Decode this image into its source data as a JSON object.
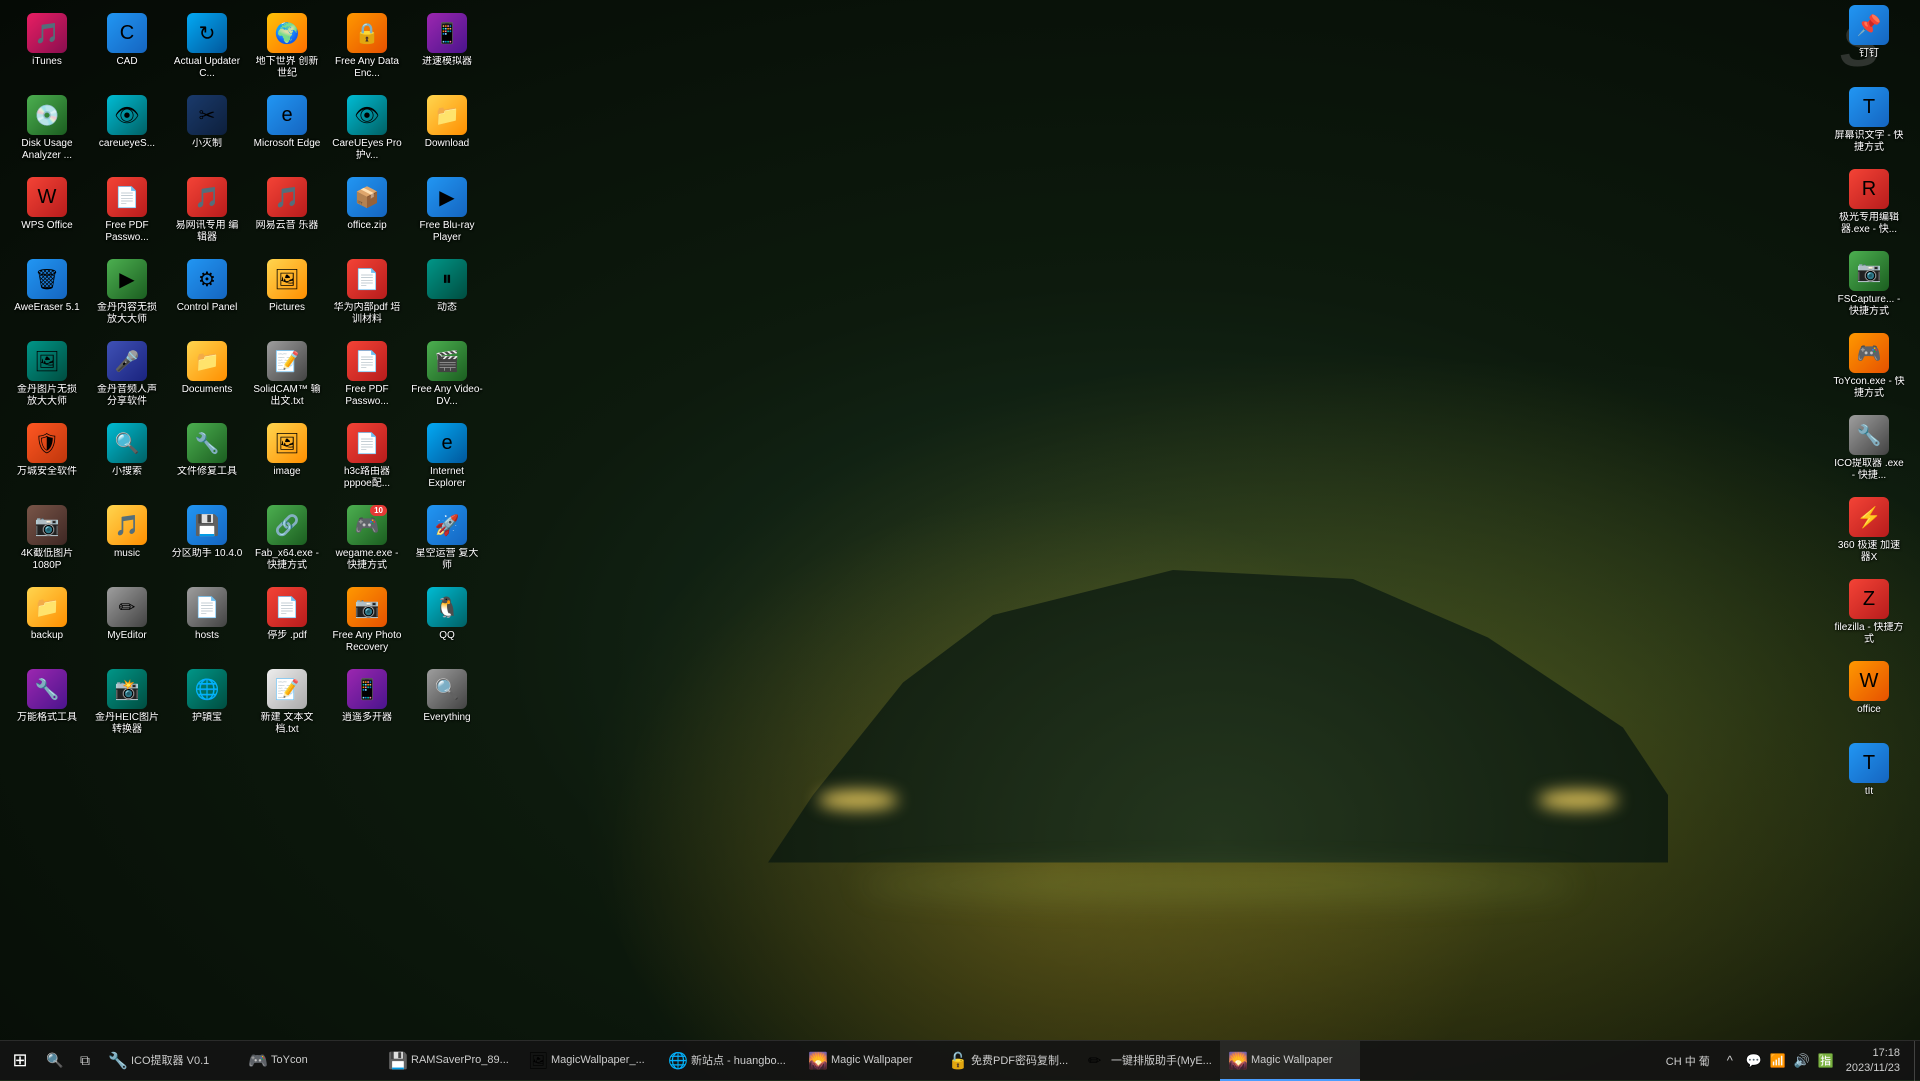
{
  "wallpaper": {
    "description": "Dark sports car with green ambient lighting"
  },
  "desktop": {
    "columns": [
      {
        "id": "col1",
        "icons": [
          {
            "id": "itunes",
            "label": "iTunes",
            "color": "ic-pink",
            "symbol": "🎵"
          },
          {
            "id": "disk-usage",
            "label": "Disk Usage\nAnalyzer ...",
            "color": "ic-green",
            "symbol": "💿"
          },
          {
            "id": "wps-office",
            "label": "WPS Office",
            "color": "ic-red",
            "symbol": "W"
          },
          {
            "id": "aweEraser",
            "label": "AweEraser\n5.1",
            "color": "ic-blue",
            "symbol": "🗑"
          },
          {
            "id": "huancang",
            "label": "金丹图片无损\n放大大师",
            "color": "ic-teal",
            "symbol": "🖼"
          },
          {
            "id": "wangcheng",
            "label": "万城安全软件",
            "color": "ic-deeporange",
            "symbol": "🛡"
          },
          {
            "id": "4k-photo",
            "label": "4K截低图片\n1080P",
            "color": "ic-brown",
            "symbol": "📷"
          },
          {
            "id": "backup",
            "label": "backup",
            "color": "ic-folder",
            "symbol": "📁"
          },
          {
            "id": "wangneng",
            "label": "万能格式工具",
            "color": "ic-purple",
            "symbol": "🔧"
          }
        ]
      },
      {
        "id": "col2",
        "icons": [
          {
            "id": "cad",
            "label": "CAD",
            "color": "ic-blue",
            "symbol": "C"
          },
          {
            "id": "careueyes",
            "label": "careueyeS...",
            "color": "ic-cyan",
            "symbol": "👁"
          },
          {
            "id": "free-pdf",
            "label": "Free PDF\nPasswo...",
            "color": "ic-red",
            "symbol": "📄"
          },
          {
            "id": "jindi-video",
            "label": "金丹内容无损\n放大大师",
            "color": "ic-green",
            "symbol": "▶"
          },
          {
            "id": "jindi-bianji",
            "label": "金丹音频人声\n分享软件",
            "color": "ic-indigo",
            "symbol": "🎤"
          },
          {
            "id": "xiaobaidu",
            "label": "小搜索",
            "color": "ic-cyan",
            "symbol": "🔍"
          },
          {
            "id": "music",
            "label": "music",
            "color": "ic-folder",
            "symbol": "🎵"
          },
          {
            "id": "myeditor",
            "label": "MyEditor",
            "color": "ic-gray",
            "symbol": "✏"
          },
          {
            "id": "jindi-heic",
            "label": "金丹HEIC图片\n转换器",
            "color": "ic-teal",
            "symbol": "📸"
          }
        ]
      },
      {
        "id": "col3",
        "icons": [
          {
            "id": "actual-updater",
            "label": "Actual\nUpdater C...",
            "color": "ic-lightblue",
            "symbol": "↻"
          },
          {
            "id": "xiaomie-c",
            "label": "小灭制",
            "color": "ic-darkblue",
            "symbol": "✂"
          },
          {
            "id": "wangyi-music",
            "label": "易网讯专用\n编辑器",
            "color": "ic-red",
            "symbol": "🎵"
          },
          {
            "id": "control-panel",
            "label": "Control\nPanel",
            "color": "ic-blue",
            "symbol": "⚙"
          },
          {
            "id": "documents",
            "label": "Documents",
            "color": "ic-folder",
            "symbol": "📁"
          },
          {
            "id": "wenjianchuli",
            "label": "文件修复工具",
            "color": "ic-green",
            "symbol": "🔧"
          },
          {
            "id": "quyu-zhushou",
            "label": "分区助手\n10.4.0",
            "color": "ic-blue",
            "symbol": "💾"
          },
          {
            "id": "hosts",
            "label": "hosts",
            "color": "ic-gray",
            "symbol": "📄"
          },
          {
            "id": "huying",
            "label": "护頴宝",
            "color": "ic-teal",
            "symbol": "🌐"
          }
        ]
      },
      {
        "id": "col4",
        "icons": [
          {
            "id": "dizhi-shijie",
            "label": "地下世界\n创新世纪",
            "color": "ic-amber",
            "symbol": "🌍"
          },
          {
            "id": "microsoft-edge",
            "label": "Microsoft\nEdge",
            "color": "ic-blue",
            "symbol": "e"
          },
          {
            "id": "wangyi-yunyin",
            "label": "网易云音\n乐器",
            "color": "ic-red",
            "symbol": "🎵"
          },
          {
            "id": "pictures",
            "label": "Pictures",
            "color": "ic-folder",
            "symbol": "🖼"
          },
          {
            "id": "solidcam-txt",
            "label": "SolidCAM™\n输出文.txt",
            "color": "ic-gray",
            "symbol": "📝"
          },
          {
            "id": "image",
            "label": "image",
            "color": "ic-folder",
            "symbol": "🖼"
          },
          {
            "id": "fab-exe",
            "label": "Fab_x64.exe\n- 快捷方式",
            "color": "ic-green",
            "symbol": "🔗"
          },
          {
            "id": "tingbu",
            "label": "停步\n.pdf",
            "color": "ic-red",
            "symbol": "📄"
          },
          {
            "id": "xinbuilding",
            "label": "新建 文本文\n档.txt",
            "color": "ic-white",
            "symbol": "📝"
          }
        ]
      },
      {
        "id": "col5",
        "icons": [
          {
            "id": "free-any-data",
            "label": "Free Any\nData Enc...",
            "color": "ic-orange",
            "symbol": "🔒"
          },
          {
            "id": "careueyes2",
            "label": "CareUEyes\nPro 护v...",
            "color": "ic-cyan",
            "symbol": "👁"
          },
          {
            "id": "office-zip",
            "label": "office.zip",
            "color": "ic-blue",
            "symbol": "📦"
          },
          {
            "id": "huawei-pdf",
            "label": "华为内部pdf\n培训材料",
            "color": "ic-red",
            "symbol": "📄"
          },
          {
            "id": "free-pdf2",
            "label": "Free PDF\nPasswo...",
            "color": "ic-red",
            "symbol": "📄"
          },
          {
            "id": "h3c-pdf",
            "label": "h3c路由器\npppoe配...",
            "color": "ic-red",
            "symbol": "📄"
          },
          {
            "id": "wegame",
            "label": "wegame.exe\n- 快捷方式",
            "color": "ic-green",
            "symbol": "🎮",
            "badge": "10"
          },
          {
            "id": "free-photo",
            "label": "Free Any\nPhoto\nRecovery",
            "color": "ic-orange",
            "symbol": "📷"
          },
          {
            "id": "duoduo-kaiti",
            "label": "逍遥多开器",
            "color": "ic-purple",
            "symbol": "📱"
          }
        ]
      },
      {
        "id": "col6",
        "icons": [
          {
            "id": "jinsuan-moni",
            "label": "进速模拟器",
            "color": "ic-purple",
            "symbol": "📱"
          },
          {
            "id": "download",
            "label": "Download",
            "color": "ic-folder",
            "symbol": "📁"
          },
          {
            "id": "free-bluray",
            "label": "Free Blu-ray\nPlayer",
            "color": "ic-blue",
            "symbol": "▶"
          },
          {
            "id": "dongtai",
            "label": "动态",
            "color": "ic-teal",
            "symbol": "⏸"
          },
          {
            "id": "free-video",
            "label": "Free Any\nVideo-DV...",
            "color": "ic-green",
            "symbol": "🎬"
          },
          {
            "id": "internet-explorer",
            "label": "Internet\nExplorer",
            "color": "ic-lightblue",
            "symbol": "e"
          },
          {
            "id": "xingkong",
            "label": "星空运营\n复大师",
            "color": "ic-blue",
            "symbol": "🚀"
          },
          {
            "id": "qq",
            "label": "QQ",
            "color": "ic-cyan",
            "symbol": "🐧"
          },
          {
            "id": "everything",
            "label": "Everything",
            "color": "ic-gray",
            "symbol": "🔍"
          }
        ]
      }
    ]
  },
  "desktop_right": {
    "icons": [
      {
        "id": "钉钉",
        "label": "钉钉",
        "color": "ic-blue",
        "symbol": "📌"
      },
      {
        "id": "screen-shortcut",
        "label": "屏幕识文字\n- 快捷方式",
        "color": "ic-blue",
        "symbol": "T"
      },
      {
        "id": "jisu-edit",
        "label": "极光专用编辑\n器.exe - 快...",
        "color": "ic-red",
        "symbol": "R"
      },
      {
        "id": "fscapture",
        "label": "FSCapture...\n- 快捷方式",
        "color": "ic-green",
        "symbol": "📷"
      },
      {
        "id": "toycon",
        "label": "ToYcon.exe\n- 快捷方式",
        "color": "ic-orange",
        "symbol": "🎮"
      },
      {
        "id": "ico-extractor",
        "label": "ICO提取器\n.exe - 快捷...",
        "color": "ic-gray",
        "symbol": "🔧"
      },
      {
        "id": "360-jiasuqi",
        "label": "360 极速\n加速器X",
        "color": "ic-red",
        "symbol": "⚡"
      },
      {
        "id": "filezilla",
        "label": "filezilla -\n快捷方式",
        "color": "ic-red",
        "symbol": "Z"
      },
      {
        "id": "office-shortcut",
        "label": "office",
        "color": "ic-orange",
        "symbol": "W"
      },
      {
        "id": "tIt-logo",
        "label": "tIt",
        "color": "ic-blue",
        "symbol": "T"
      }
    ]
  },
  "taskbar": {
    "start_label": "⊞",
    "apps": [
      {
        "id": "ico-extractor-task",
        "label": "ICO提取器 V0.1",
        "color": "#555",
        "symbol": "🔧"
      },
      {
        "id": "toycon-task",
        "label": "ToYcon",
        "color": "#555",
        "symbol": "🎮"
      },
      {
        "id": "ramsaver-task",
        "label": "RAMSaverPro_89...",
        "color": "#555",
        "symbol": "💾"
      },
      {
        "id": "magic-wallpaper-task",
        "label": "MagicWallpaper_...",
        "color": "#555",
        "symbol": "🖼"
      },
      {
        "id": "xin-jiankuang-task",
        "label": "新站点 - huangbo...",
        "color": "#555",
        "symbol": "🌐"
      },
      {
        "id": "magic-wallpaper2-task",
        "label": "Magic Wallpaper",
        "color": "#555",
        "symbol": "🌄"
      },
      {
        "id": "mian-mi-task",
        "label": "免费PDF密码复制...",
        "color": "#555",
        "symbol": "🔓"
      },
      {
        "id": "yijian-task",
        "label": "一键排版助手(MyE...",
        "color": "#555",
        "symbol": "✏"
      },
      {
        "id": "magic-wallpaper3-task",
        "label": "Magic Wallpaper",
        "color": "#555",
        "symbol": "🌄",
        "active": true
      }
    ],
    "tray": {
      "icons": [
        "^",
        "💬",
        "📶",
        "🔊",
        "🈯"
      ],
      "time": "17:18",
      "date": "2023/11/23",
      "lang": "CH 中 葡"
    }
  },
  "s_logo": "S"
}
